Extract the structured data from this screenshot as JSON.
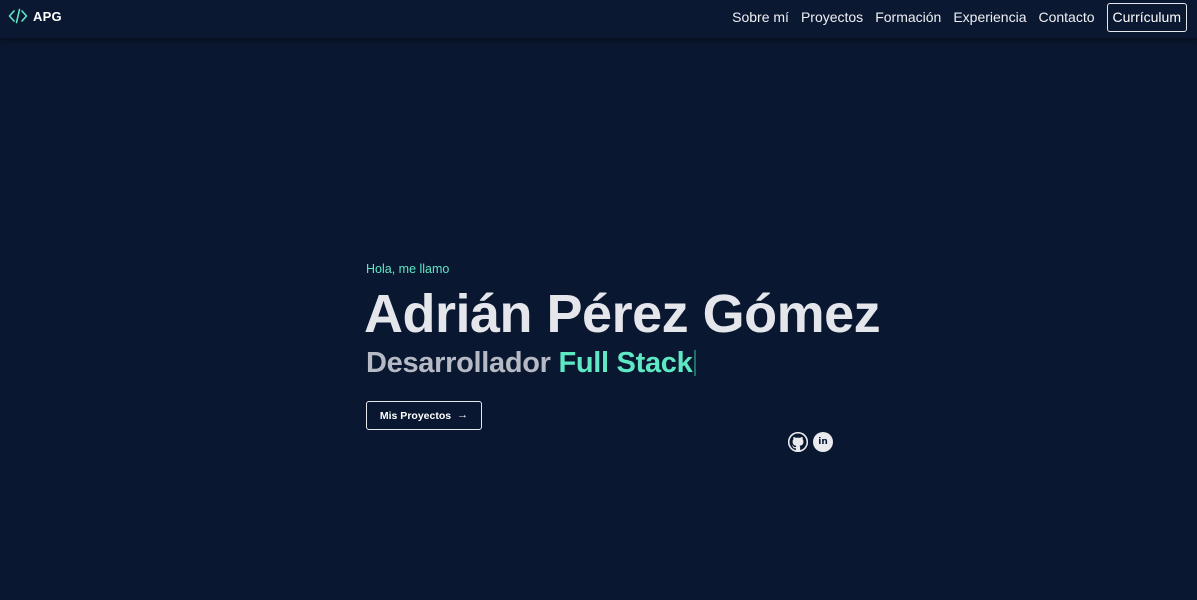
{
  "brand": {
    "icon": "code-brackets-icon",
    "text": "APG",
    "accent_color": "#5ee8c4"
  },
  "nav": {
    "links": [
      {
        "label": "Sobre mí"
      },
      {
        "label": "Proyectos"
      },
      {
        "label": "Formación"
      },
      {
        "label": "Experiencia"
      },
      {
        "label": "Contacto"
      }
    ],
    "cv_label": "Currículum"
  },
  "hero": {
    "greeting": "Hola, me llamo",
    "name": "Adrián Pérez Gómez",
    "role_prefix": "Desarrollador ",
    "role_highlight": "Full Stack",
    "projects_button": "Mis Proyectos",
    "projects_button_icon": "arrow-right-icon",
    "arrow_glyph": "→"
  },
  "socials": [
    {
      "name": "github-icon"
    },
    {
      "name": "linkedin-icon",
      "glyph": "in"
    }
  ],
  "colors": {
    "background": "#0a1730",
    "accent": "#5ee8c4",
    "text": "#e4e6ec",
    "muted": "#b6bac4"
  }
}
